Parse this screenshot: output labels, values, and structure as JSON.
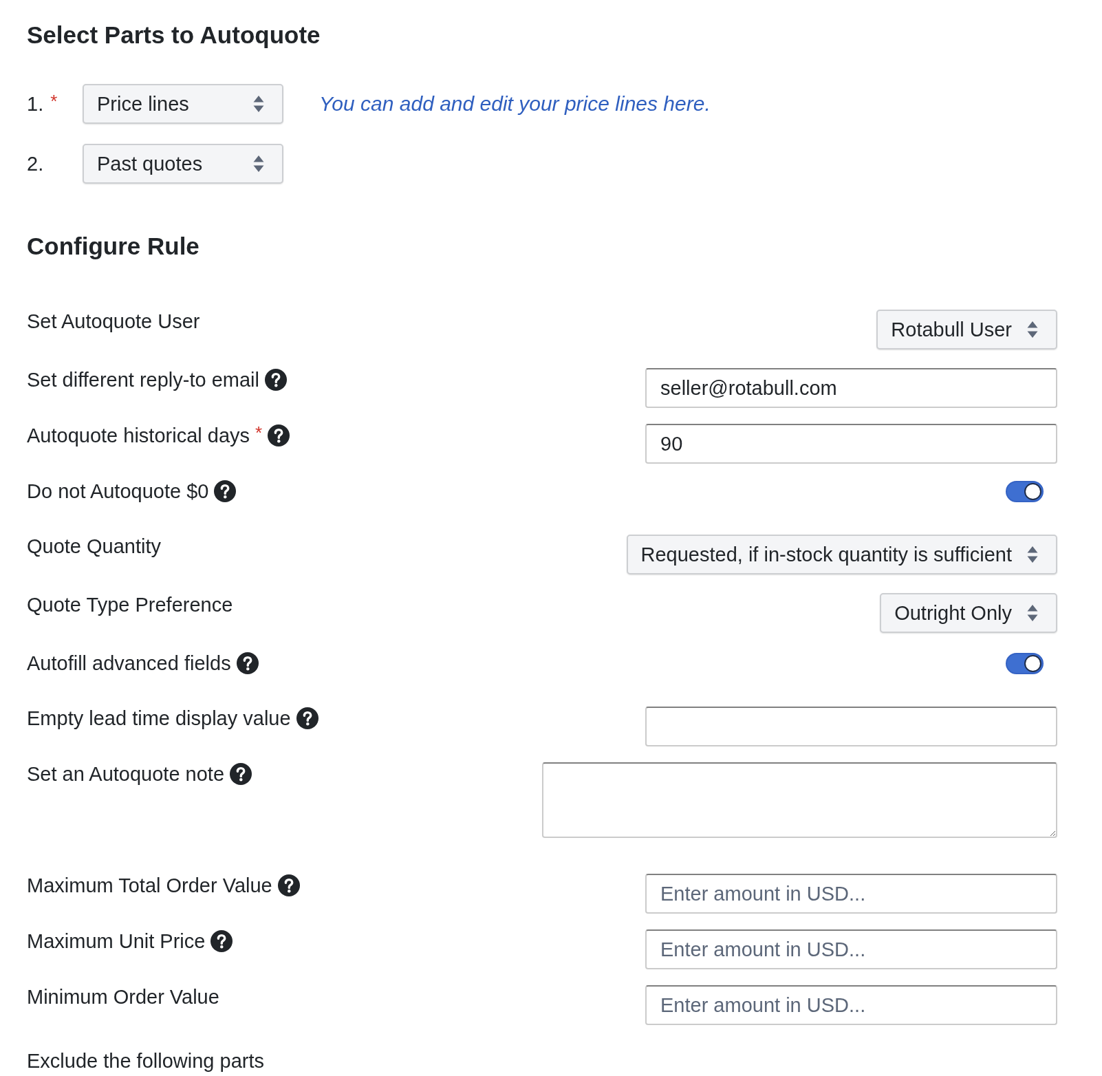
{
  "parts": {
    "title": "Select Parts to Autoquote",
    "sources": [
      {
        "number": "1.",
        "required_mark": "*",
        "value": "Price lines",
        "link": "You can add and edit your price lines here."
      },
      {
        "number": "2.",
        "value": "Past quotes"
      }
    ]
  },
  "rule": {
    "title": "Configure Rule",
    "fields": [
      {
        "kind": "select",
        "label": "Set Autoquote User",
        "help": false,
        "value": "Rotabull User"
      },
      {
        "kind": "input",
        "label": "Set different reply-to email",
        "help": true,
        "value": "seller@rotabull.com"
      },
      {
        "kind": "input",
        "label": "Autoquote historical days",
        "required_mark": "*",
        "help": true,
        "value": "90"
      },
      {
        "kind": "toggle",
        "label": "Do not Autoquote $0",
        "help": true,
        "on": true
      },
      {
        "kind": "select",
        "label": "Quote Quantity",
        "help": false,
        "value": "Requested, if in-stock quantity is sufficient"
      },
      {
        "kind": "select",
        "label": "Quote Type Preference",
        "help": false,
        "value": "Outright Only"
      },
      {
        "kind": "toggle",
        "label": "Autofill advanced fields",
        "help": true,
        "on": true
      },
      {
        "kind": "input",
        "label": "Empty lead time display value",
        "help": true
      },
      {
        "kind": "textarea",
        "label": "Set an Autoquote note",
        "help": true
      },
      {
        "kind": "input",
        "label": "Maximum Total Order Value",
        "help": true,
        "placeholder": "Enter amount in USD..."
      },
      {
        "kind": "input",
        "label": "Maximum Unit Price",
        "help": true,
        "placeholder": "Enter amount in USD..."
      },
      {
        "kind": "input",
        "label": "Minimum Order Value",
        "help": false,
        "placeholder": "Enter amount in USD..."
      },
      {
        "kind": "label",
        "label": "Exclude the following parts",
        "help": false
      }
    ]
  }
}
